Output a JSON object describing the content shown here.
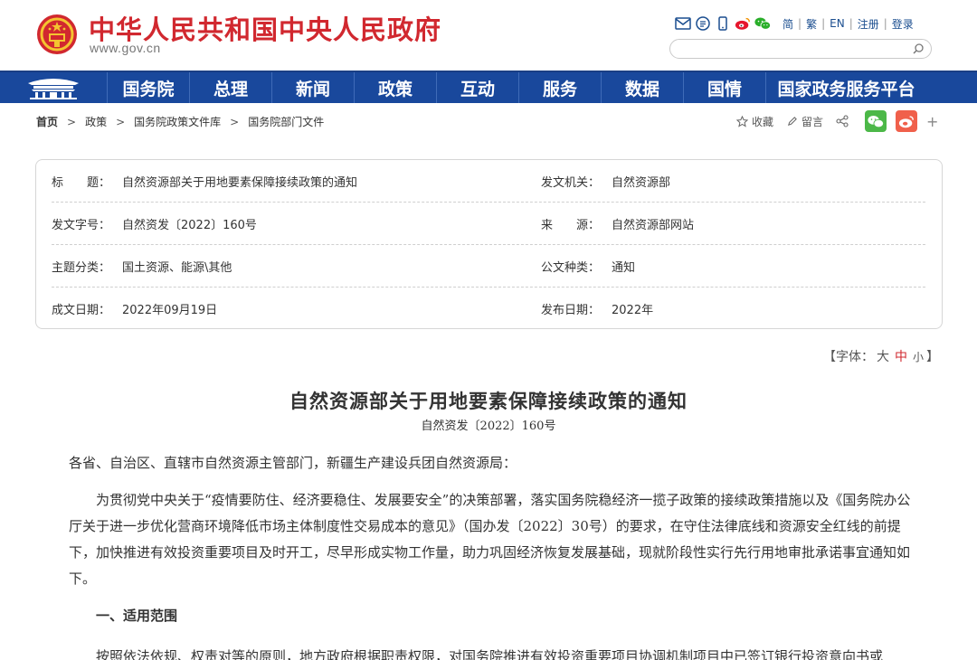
{
  "header": {
    "site_title": "中华人民共和国中央人民政府",
    "site_domain": "www.gov.cn",
    "top_links": [
      "简",
      "繁",
      "EN",
      "注册",
      "登录"
    ],
    "search_placeholder": ""
  },
  "nav": {
    "items": [
      "国务院",
      "总理",
      "新闻",
      "政策",
      "互动",
      "服务",
      "数据",
      "国情",
      "国家政务服务平台"
    ]
  },
  "breadcrumb": {
    "items": [
      "首页",
      "政策",
      "国务院政策文件库",
      "国务院部门文件"
    ]
  },
  "share": {
    "favorite": "收藏",
    "comment": "留言",
    "plus": "+"
  },
  "meta": {
    "rows": [
      {
        "l_label": "标　　题：",
        "l_value": "自然资源部关于用地要素保障接续政策的通知",
        "r_label": "发文机关：",
        "r_value": "自然资源部"
      },
      {
        "l_label": "发文字号：",
        "l_value": "自然资发〔2022〕160号",
        "r_label": "来　　源：",
        "r_value": "自然资源部网站"
      },
      {
        "l_label": "主题分类：",
        "l_value": "国土资源、能源\\其他",
        "r_label": "公文种类：",
        "r_value": "通知"
      },
      {
        "l_label": "成文日期：",
        "l_value": "2022年09月19日",
        "r_label": "发布日期：",
        "r_value": "2022年"
      }
    ]
  },
  "font_ctrl": {
    "prefix": "【字体：",
    "big": "大",
    "mid": "中",
    "small": "小",
    "suffix": "】"
  },
  "article": {
    "title": "自然资源部关于用地要素保障接续政策的通知",
    "doc_no": "自然资发〔2022〕160号",
    "salutation": "各省、自治区、直辖市自然资源主管部门，新疆生产建设兵团自然资源局：",
    "para1": "为贯彻党中央关于“疫情要防住、经济要稳住、发展要安全”的决策部署，落实国务院稳经济一揽子政策的接续政策措施以及《国务院办公厅关于进一步优化营商环境降低市场主体制度性交易成本的意见》（国办发〔2022〕30号）的要求，在守住法律底线和资源安全红线的前提下，加快推进有效投资重要项目及时开工，尽早形成实物工作量，助力巩固经济恢复发展基础，现就阶段性实行先行用地审批承诺事宜通知如下。",
    "heading1": "一、适用范围",
    "para2": "按照依法依规、权责对等的原则，地方政府根据职责权限，对国务院推进有效投资重要项目协调机制项目中已签订银行投资意向书或"
  },
  "colors": {
    "brand_red": "#d1282f",
    "nav_blue": "#19489c"
  }
}
